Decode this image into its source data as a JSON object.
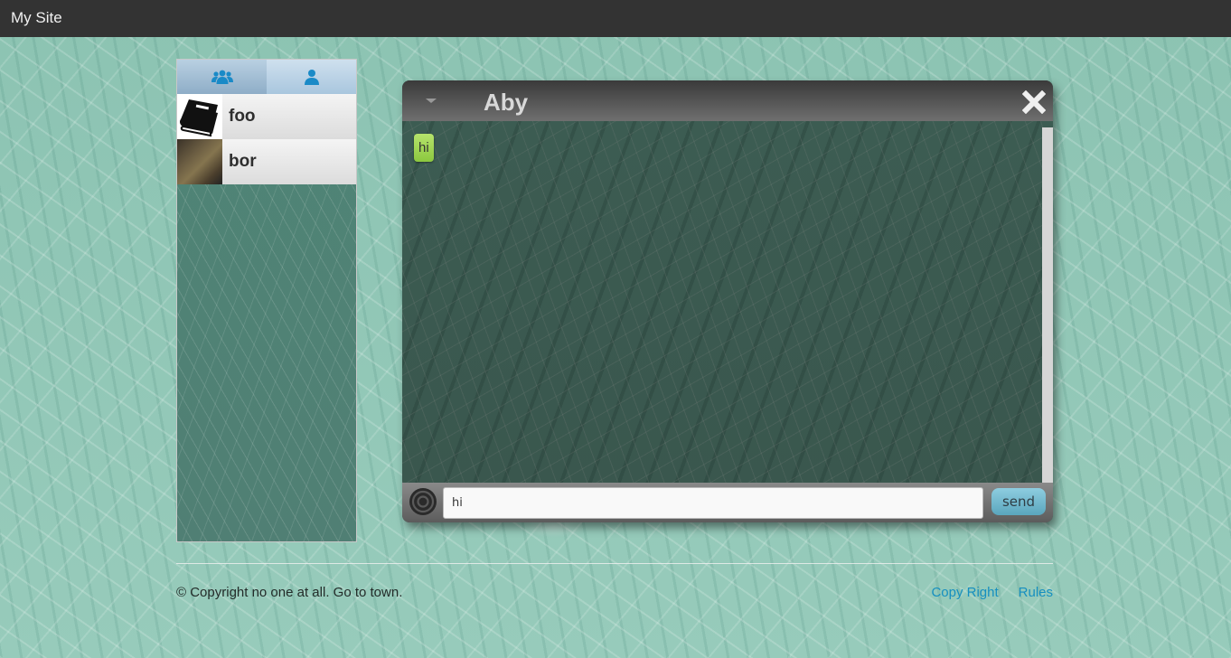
{
  "navbar": {
    "brand": "My Site"
  },
  "sidebar": {
    "tabs": [
      {
        "icon": "group-icon",
        "active": true
      },
      {
        "icon": "user-icon",
        "active": false
      }
    ],
    "contacts": [
      {
        "name": "foo",
        "avatar": "book-image"
      },
      {
        "name": "bor",
        "avatar": "photo"
      }
    ]
  },
  "chat": {
    "title": "Aby",
    "messages": [
      {
        "text": "hi",
        "color": "#9cd24d"
      }
    ],
    "input": {
      "value": "hi"
    },
    "send_label": "send"
  },
  "footer": {
    "copyright": "© Copyright no one at all. Go to town.",
    "links": [
      "Copy Right",
      "Rules"
    ]
  },
  "colors": {
    "navbar": "#333333",
    "link": "#168fc0",
    "tab_icon": "#1a8ac7",
    "send_button": "#6fb6cb"
  }
}
